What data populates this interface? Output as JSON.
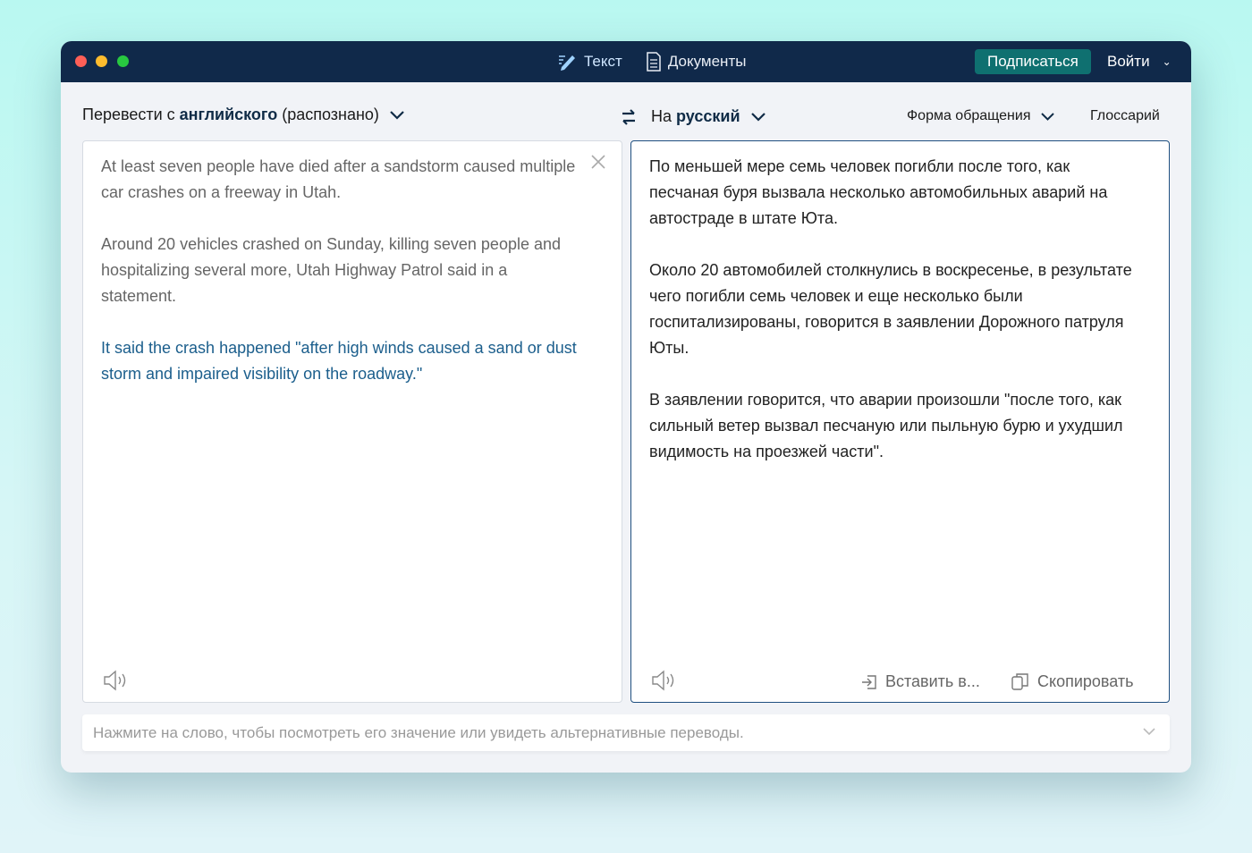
{
  "titlebar": {
    "tabs": [
      {
        "label": "Текст",
        "icon": "pen-icon"
      },
      {
        "label": "Документы",
        "icon": "document-icon"
      }
    ],
    "subscribe": "Подписаться",
    "login": "Войти"
  },
  "source": {
    "prefix": "Перевести с",
    "language": "английского",
    "suffix": "(распознано)",
    "paragraphs": [
      "At least seven people have died after a sandstorm caused multiple car crashes on a freeway in Utah.",
      "Around 20 vehicles crashed on Sunday, killing seven people and hospitalizing several more, Utah Highway Patrol said in a statement.",
      "It said the crash happened \"after high winds caused a sand or dust storm and impaired visibility on the roadway.\""
    ]
  },
  "target": {
    "prefix": "На",
    "language": "русский",
    "formality": "Форма обращения",
    "glossary": "Глоссарий",
    "paragraphs": [
      "По меньшей мере семь человек погибли после того, как песчаная буря вызвала несколько автомобильных аварий на автостраде в штате Юта.",
      "Около 20 автомобилей столкнулись в воскресенье, в результате чего погибли семь человек и еще несколько были госпитализированы, говорится в заявлении Дорожного патруля Юты.",
      "В заявлении говорится, что аварии произошли \"после того, как сильный ветер вызвал песчаную или пыльную бурю и ухудшил видимость на проезжей части\"."
    ],
    "insert": "Вставить в...",
    "copy": "Скопировать"
  },
  "hint": "Нажмите на слово, чтобы посмотреть его значение или увидеть альтернативные переводы.",
  "colors": {
    "titlebar": "#10294a",
    "accent": "#0f7070",
    "highlight": "#1b5e8c"
  }
}
